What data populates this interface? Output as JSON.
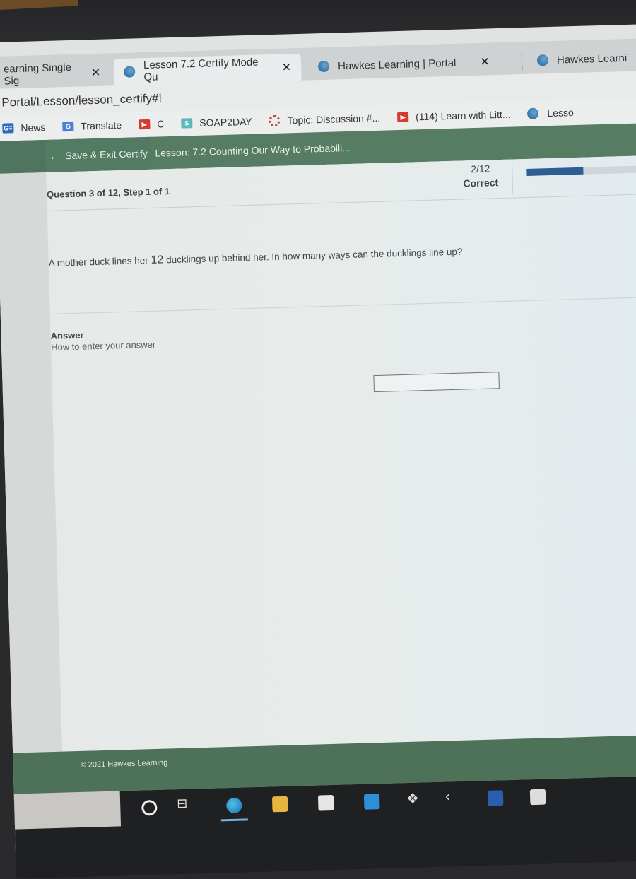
{
  "browser": {
    "tabs": [
      {
        "label": "earning Single Sig",
        "active": false,
        "icon": "hawkes-logo-icon"
      },
      {
        "label": "Lesson 7.2 Certify Mode Qu",
        "active": true,
        "icon": "hawkes-logo-icon"
      },
      {
        "label": "Hawkes Learning | Portal",
        "active": false,
        "icon": "hawkes-logo-icon"
      },
      {
        "label": "Hawkes Learni",
        "active": false,
        "icon": "hawkes-logo-icon"
      }
    ],
    "close_glyph": "✕",
    "url": "Portal/Lesson/lesson_certify#!",
    "bookmarks": [
      {
        "label": "News",
        "icon": "google-news-icon",
        "glyph": "G≡"
      },
      {
        "label": "Translate",
        "icon": "google-translate-icon",
        "glyph": "G"
      },
      {
        "label": "C",
        "icon": "youtube-icon",
        "glyph": "▶"
      },
      {
        "label": "SOAP2DAY",
        "icon": "soap2day-icon",
        "glyph": "S"
      },
      {
        "label": "Topic: Discussion #...",
        "icon": "canvas-icon",
        "glyph": ""
      },
      {
        "label": "(114) Learn with Litt...",
        "icon": "youtube-icon",
        "glyph": "▶"
      },
      {
        "label": "Lesso",
        "icon": "hawkes-logo-icon",
        "glyph": ""
      }
    ]
  },
  "app": {
    "save_exit_label": "Save & Exit Certify",
    "save_exit_arrow": "←",
    "lesson_title": "Lesson: 7.2 Counting Our Way to Probabili...",
    "question_label": "Question 3 of 12, Step 1 of 1",
    "score": {
      "value": "2/12",
      "label": "Correct"
    },
    "progress_fraction": 0.4,
    "accent_color": "#567d64",
    "progress_color": "#2e5e93",
    "question_text_before": "A mother duck lines her ",
    "question_number": "12",
    "question_text_after": " ducklings up behind her.  In how many ways can the ducklings line up?",
    "answer_label": "Answer",
    "howto_label": "How to enter your answer",
    "answer_value": "",
    "footer": "© 2021 Hawkes Learning"
  },
  "taskbar": {
    "icons": [
      "search-icon",
      "task-view-icon",
      "edge-icon",
      "file-explorer-icon",
      "store-icon",
      "mail-icon",
      "dropbox-icon",
      "app-icon",
      "word-icon",
      "help-icon"
    ],
    "task_view_glyph": "⊟",
    "dropbox_glyph": "❖",
    "other_glyph": "‹"
  }
}
